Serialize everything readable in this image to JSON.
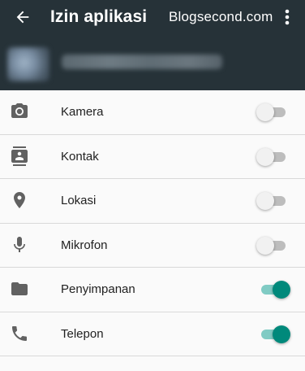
{
  "header": {
    "title": "Izin aplikasi",
    "watermark": "Blogsecond.com",
    "background": "#263238",
    "back_icon": "arrow-back-icon",
    "overflow_icon": "more-vert-icon"
  },
  "app": {
    "icon": "blurred-app-icon",
    "name": ""
  },
  "permissions": [
    {
      "label": "Kamera",
      "icon": "camera-icon",
      "enabled": false
    },
    {
      "label": "Kontak",
      "icon": "contacts-icon",
      "enabled": false
    },
    {
      "label": "Lokasi",
      "icon": "location-icon",
      "enabled": false
    },
    {
      "label": "Mikrofon",
      "icon": "microphone-icon",
      "enabled": false
    },
    {
      "label": "Penyimpanan",
      "icon": "folder-icon",
      "enabled": true
    },
    {
      "label": "Telepon",
      "icon": "phone-icon",
      "enabled": true
    }
  ],
  "colors": {
    "accent": "#00897b",
    "accent_track": "#80cbc4",
    "icon_gray": "#616161"
  }
}
